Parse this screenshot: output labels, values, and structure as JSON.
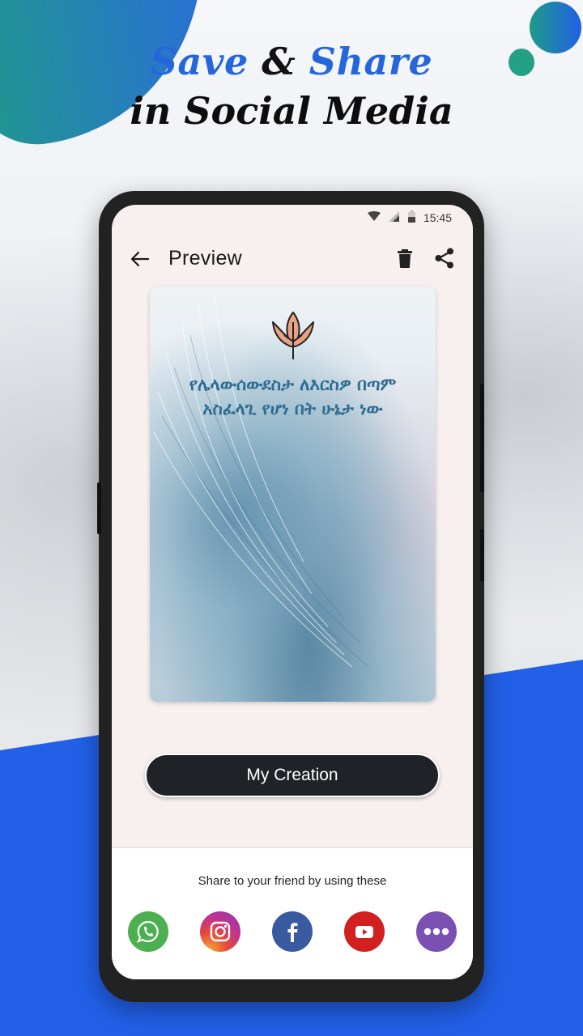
{
  "promo": {
    "headline_word1": "Save",
    "headline_amp": "&",
    "headline_word2": "Share",
    "headline_line2": "in Social Media",
    "accent_color": "#2566dc",
    "background_blue": "#2260e8"
  },
  "status_bar": {
    "time": "15:45",
    "icons": [
      "wifi-icon",
      "signal-icon",
      "battery-icon"
    ]
  },
  "app_bar": {
    "title": "Preview",
    "back_icon": "arrow-left-icon",
    "actions": [
      "delete-icon",
      "share-icon"
    ]
  },
  "preview_card": {
    "emblem_icon": "leaf-icon",
    "quote_line1": "የሌላውሰውደስታ ለእርስዎ በጣም",
    "quote_line2": "አስፈላጊ የሆነ በት ሁኔታ ነው"
  },
  "primary_button": {
    "label": "My Creation"
  },
  "share": {
    "label": "Share to your friend by using these",
    "targets": [
      {
        "name": "WhatsApp",
        "icon": "whatsapp-icon",
        "color": "#4caf50"
      },
      {
        "name": "Instagram",
        "icon": "instagram-icon",
        "color": "#c0338e"
      },
      {
        "name": "Facebook",
        "icon": "facebook-icon",
        "color": "#3a5a9f"
      },
      {
        "name": "YouTube",
        "icon": "youtube-icon",
        "color": "#d21f1f"
      },
      {
        "name": "More",
        "icon": "more-icon",
        "color": "#7c4fb3"
      }
    ]
  }
}
